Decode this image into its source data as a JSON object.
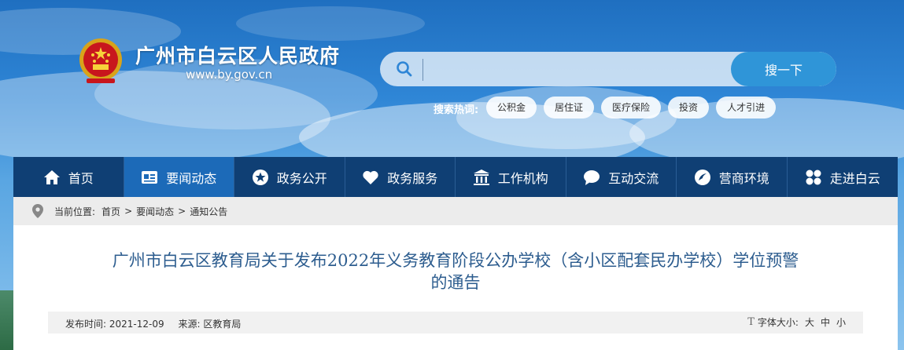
{
  "header": {
    "site_title": "广州市白云区人民政府",
    "site_url": "www.by.gov.cn"
  },
  "search": {
    "placeholder": "",
    "value": "",
    "button_label": "搜一下",
    "hot_label": "搜索热词:",
    "hot_tags": [
      "公积金",
      "居住证",
      "医疗保险",
      "投资",
      "人才引进"
    ]
  },
  "nav": {
    "items": [
      {
        "label": "首页",
        "icon": "home-icon"
      },
      {
        "label": "要闻动态",
        "icon": "news-card-icon"
      },
      {
        "label": "政务公开",
        "icon": "star-circle-icon"
      },
      {
        "label": "政务服务",
        "icon": "heart-icon"
      },
      {
        "label": "工作机构",
        "icon": "institution-building-icon"
      },
      {
        "label": "互动交流",
        "icon": "chat-bubble-icon"
      },
      {
        "label": "营商环境",
        "icon": "business-swirl-icon"
      },
      {
        "label": "走进白云",
        "icon": "four-petal-icon"
      }
    ],
    "active_index": 1
  },
  "breadcrumb": {
    "prefix": "当前位置:",
    "items": [
      "首页",
      "要闻动态",
      "通知公告"
    ],
    "separator": ">"
  },
  "article": {
    "title_line1": "广州市白云区教育局关于发布2022年义务教育阶段公办学校（含小区配套民办学校）学位预警",
    "title_line2": "的通告",
    "publish_label": "发布时间:",
    "publish_date": "2021-12-09",
    "source_label": "来源:",
    "source": "区教育局",
    "font_size_label": "字体大小:",
    "font_sizes": [
      "大",
      "中",
      "小"
    ]
  },
  "colors": {
    "nav_bg": "#0f3f74",
    "nav_active": "#1c6ab8",
    "search_button": "#2f95d8",
    "title_text": "#2d5d8f"
  }
}
